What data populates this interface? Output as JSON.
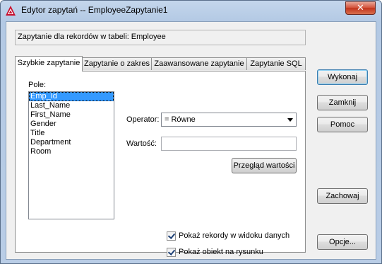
{
  "window": {
    "title": "Edytor zapytań -- EmployeeZapytanie1",
    "close": "✕"
  },
  "info": {
    "text": "Zapytanie dla rekordów w tabeli:  Employee"
  },
  "tabs": [
    {
      "label": "Szybkie zapytanie"
    },
    {
      "label": "Zapytanie o zakres"
    },
    {
      "label": "Zaawansowane zapytanie"
    },
    {
      "label": "Zapytanie SQL"
    }
  ],
  "fields": {
    "label": "Pole:",
    "items": [
      "Emp_Id",
      "Last_Name",
      "First_Name",
      "Gender",
      "Title",
      "Department",
      "Room"
    ],
    "selected": "Emp_Id"
  },
  "operator": {
    "label": "Operator:",
    "value": "=   Równe"
  },
  "value": {
    "label": "Wartość:",
    "current": ""
  },
  "browse_button": "Przegląd wartości",
  "checkboxes": {
    "show_records": {
      "label": "Pokaż rekordy w widoku danych",
      "checked": true
    },
    "show_object": {
      "label": "Pokaż obiekt na rysunku",
      "checked": true
    }
  },
  "buttons": {
    "execute": "Wykonaj",
    "close": "Zamknij",
    "help": "Pomoc",
    "save": "Zachowaj",
    "options": "Opcje..."
  }
}
